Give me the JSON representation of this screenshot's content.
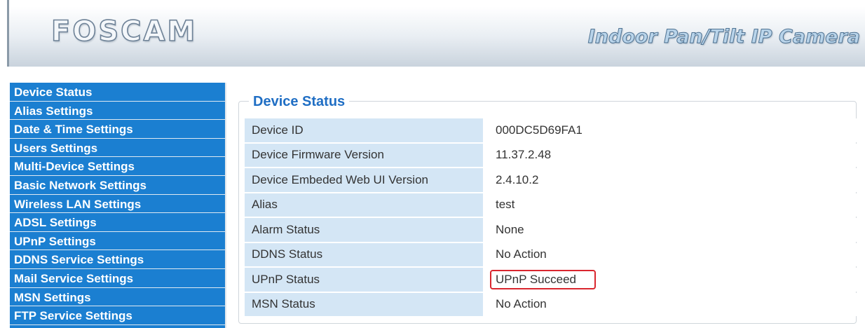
{
  "header": {
    "logo": "FOSCAM",
    "product_title": "Indoor Pan/Tilt IP Camera"
  },
  "sidebar": {
    "items": [
      {
        "label": "Device Status"
      },
      {
        "label": "Alias Settings"
      },
      {
        "label": "Date & Time Settings"
      },
      {
        "label": "Users Settings"
      },
      {
        "label": "Multi-Device Settings"
      },
      {
        "label": "Basic Network Settings"
      },
      {
        "label": "Wireless LAN Settings"
      },
      {
        "label": "ADSL Settings"
      },
      {
        "label": "UPnP Settings"
      },
      {
        "label": "DDNS Service Settings"
      },
      {
        "label": "Mail Service Settings"
      },
      {
        "label": "MSN Settings"
      },
      {
        "label": "FTP Service Settings"
      }
    ]
  },
  "main": {
    "title": "Device Status",
    "rows": [
      {
        "label": "Device ID",
        "value": "000DC5D69FA1"
      },
      {
        "label": "Device Firmware Version",
        "value": "11.37.2.48"
      },
      {
        "label": "Device Embeded Web UI Version",
        "value": "2.4.10.2"
      },
      {
        "label": "Alias",
        "value": "test"
      },
      {
        "label": "Alarm Status",
        "value": "None"
      },
      {
        "label": "DDNS Status",
        "value": "No Action"
      },
      {
        "label": "UPnP Status",
        "value": "UPnP Succeed"
      },
      {
        "label": "MSN Status",
        "value": "No Action"
      }
    ]
  },
  "colors": {
    "sidebar_bg": "#1b7fd1",
    "label_cell_bg": "#d4e6f5",
    "title_color": "#1f6ec4",
    "highlight_border": "#d9262e"
  }
}
